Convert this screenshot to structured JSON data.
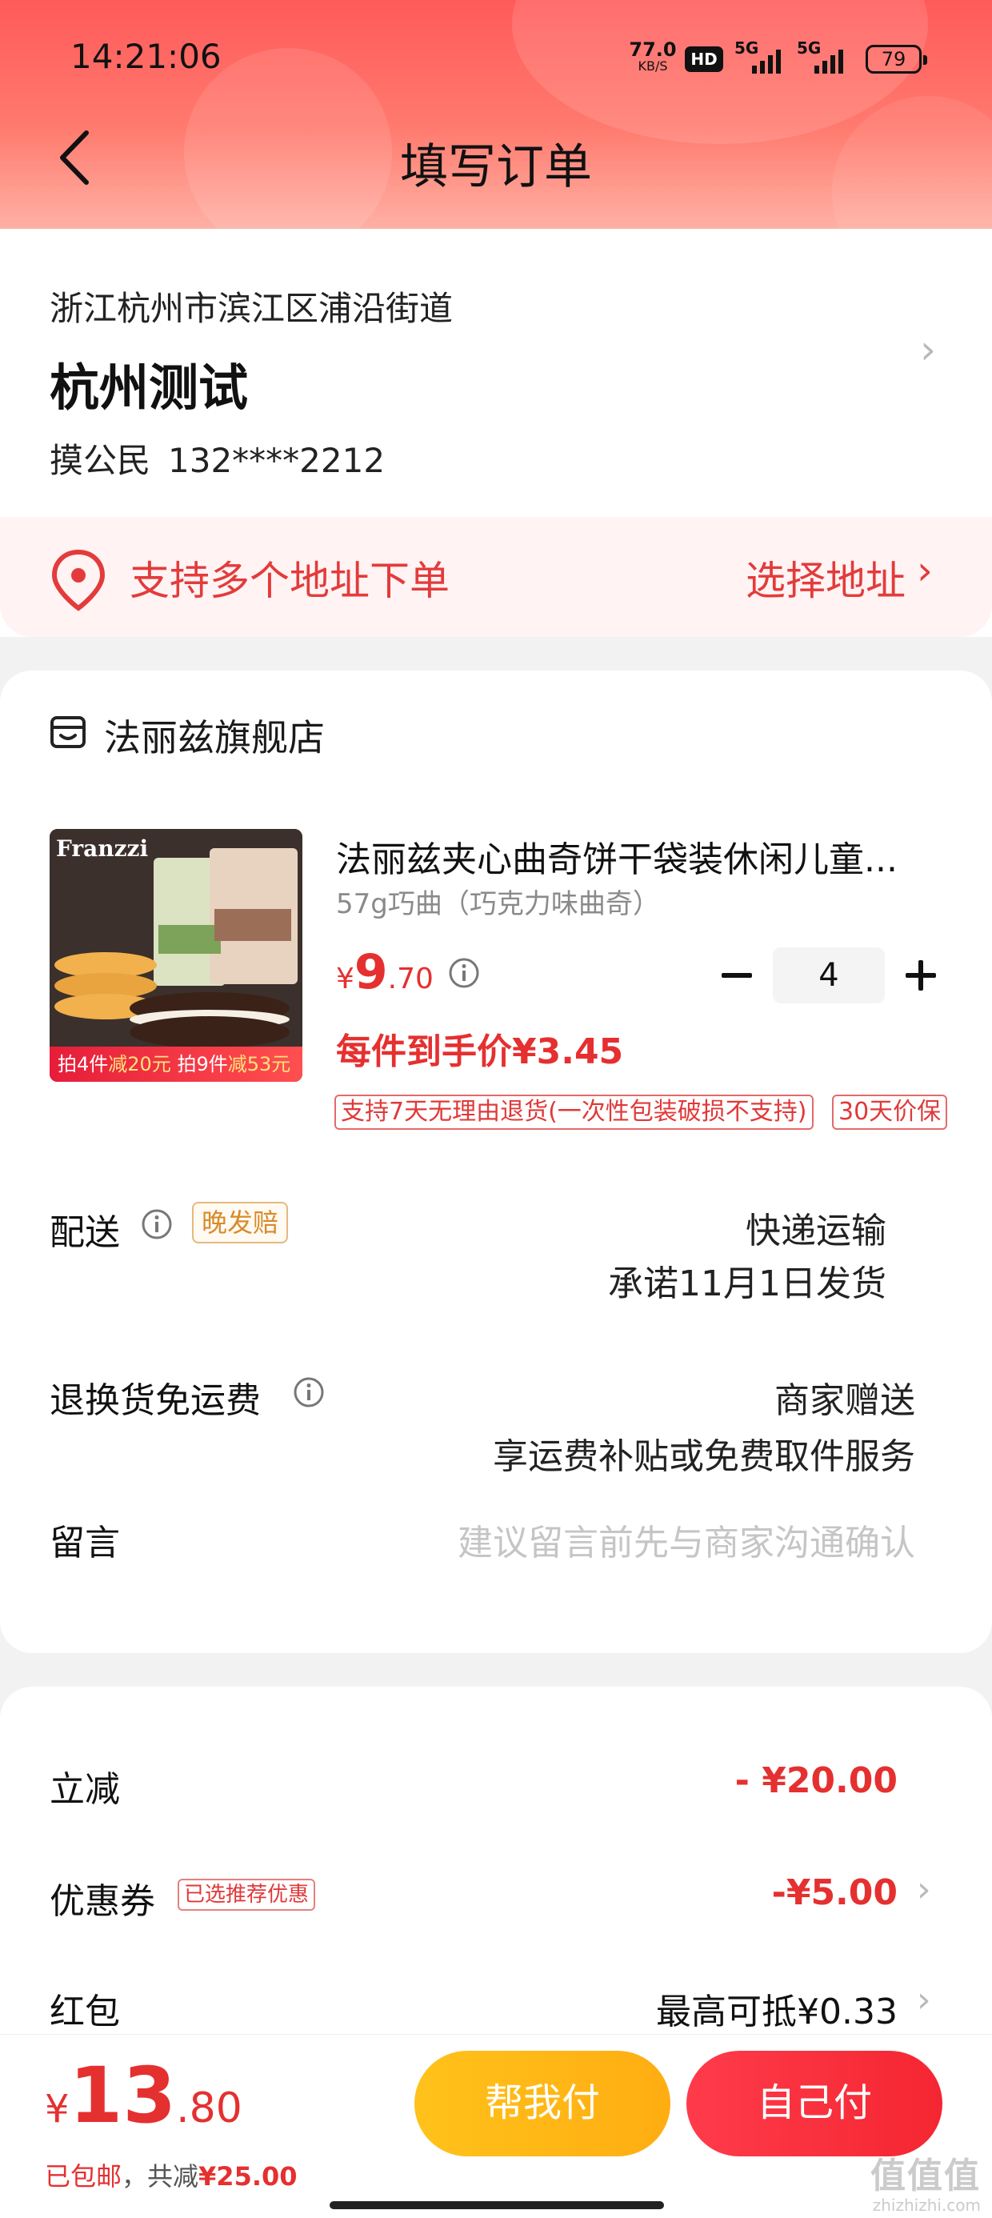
{
  "status_bar": {
    "time": "14:21:06",
    "net_speed_value": "77.0",
    "net_speed_unit": "KB/S",
    "hd": "HD",
    "sim1": "5G",
    "sim2": "5G",
    "battery": "79"
  },
  "nav": {
    "title": "填写订单",
    "back_icon": "chevron-left-icon"
  },
  "address": {
    "area": "浙江杭州市滨江区浦沿街道",
    "name": "杭州测试",
    "contact_name": "摸公民",
    "phone": "132****2212",
    "multi_text": "支持多个地址下单",
    "select_label": "选择地址",
    "chevron": "›"
  },
  "shop": {
    "name": "法丽兹旗舰店"
  },
  "product": {
    "title": "法丽兹夹心曲奇饼干袋装休闲儿童...",
    "sku": "57g巧曲（巧克力味曲奇）",
    "price_symbol": "¥",
    "price_int": "9",
    "price_dec": ".70",
    "quantity": "4",
    "unit_price": "每件到手价¥3.45",
    "tags": [
      "支持7天无理由退货(一次性包装破损不支持)",
      "30天价保"
    ],
    "thumb_brand": "Franzzi",
    "thumb_banner_a": "拍4件",
    "thumb_banner_b": "减20元",
    "thumb_banner_c": "拍9件",
    "thumb_banner_d": "减53元"
  },
  "delivery": {
    "label": "配送",
    "badge": "晚发赔",
    "method": "快递运输",
    "promise": "承诺11月1日发货"
  },
  "return_shipping": {
    "label": "退换货免运费",
    "value": "商家赠送",
    "sub": "享运费补贴或免费取件服务"
  },
  "message": {
    "label": "留言",
    "placeholder": "建议留言前先与商家沟通确认"
  },
  "discounts": {
    "instant_label": "立减",
    "instant_value": "- ¥20.00",
    "coupon_label": "优惠券",
    "coupon_badge": "已选推荐优惠",
    "coupon_value": "-¥5.00",
    "redpacket_label": "红包",
    "redpacket_value": "最高可抵¥0.33"
  },
  "bottom": {
    "currency": "¥",
    "total_int": "13",
    "total_dec": ".80",
    "shipping_note": "已包邮",
    "sep": "，共减",
    "saved": "¥25.00",
    "friend_pay": "帮我付",
    "self_pay": "自己付"
  },
  "watermark": {
    "big": "值值值",
    "small": "zhizhizhi.com"
  },
  "colors": {
    "accent_red": "#e53030",
    "button_yellow": "#ffb516",
    "button_red": "#f42631",
    "header_red": "#ff5a5a"
  }
}
